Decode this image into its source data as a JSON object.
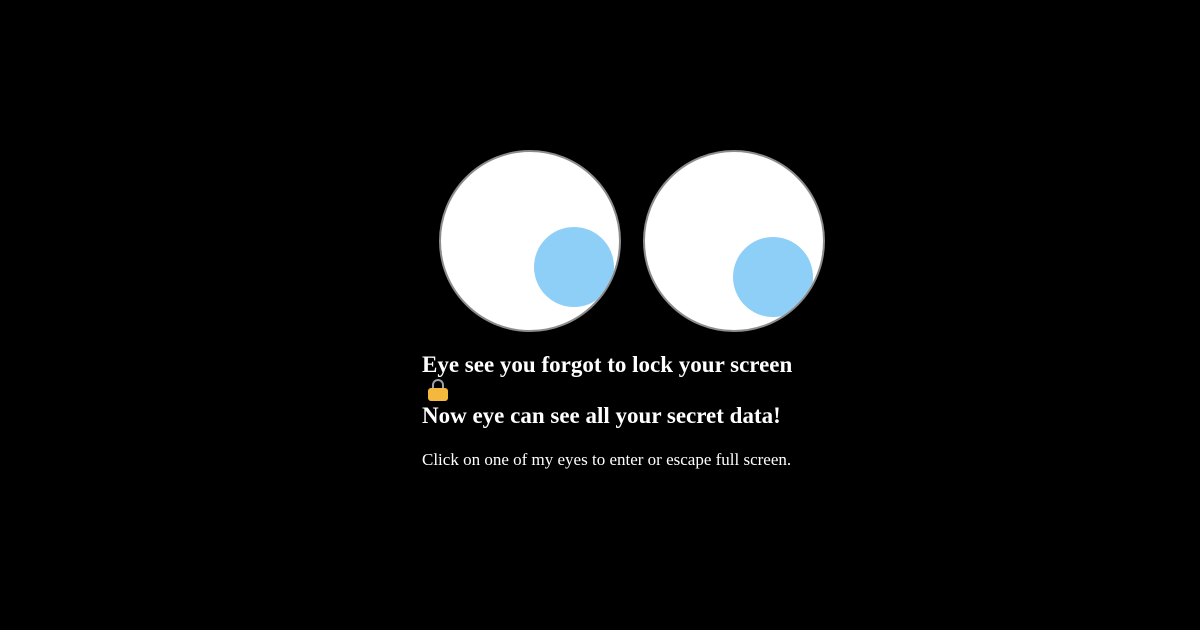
{
  "colors": {
    "background": "#000000",
    "text": "#ffffff",
    "pupil": "#8ecff8",
    "lock": "#f4b93c"
  },
  "headline": {
    "line1": "Eye see you forgot to lock your screen",
    "line2": "Now eye can see all your secret data!",
    "icon": "lock-icon"
  },
  "hint": "Click on one of my eyes to enter or escape full screen."
}
